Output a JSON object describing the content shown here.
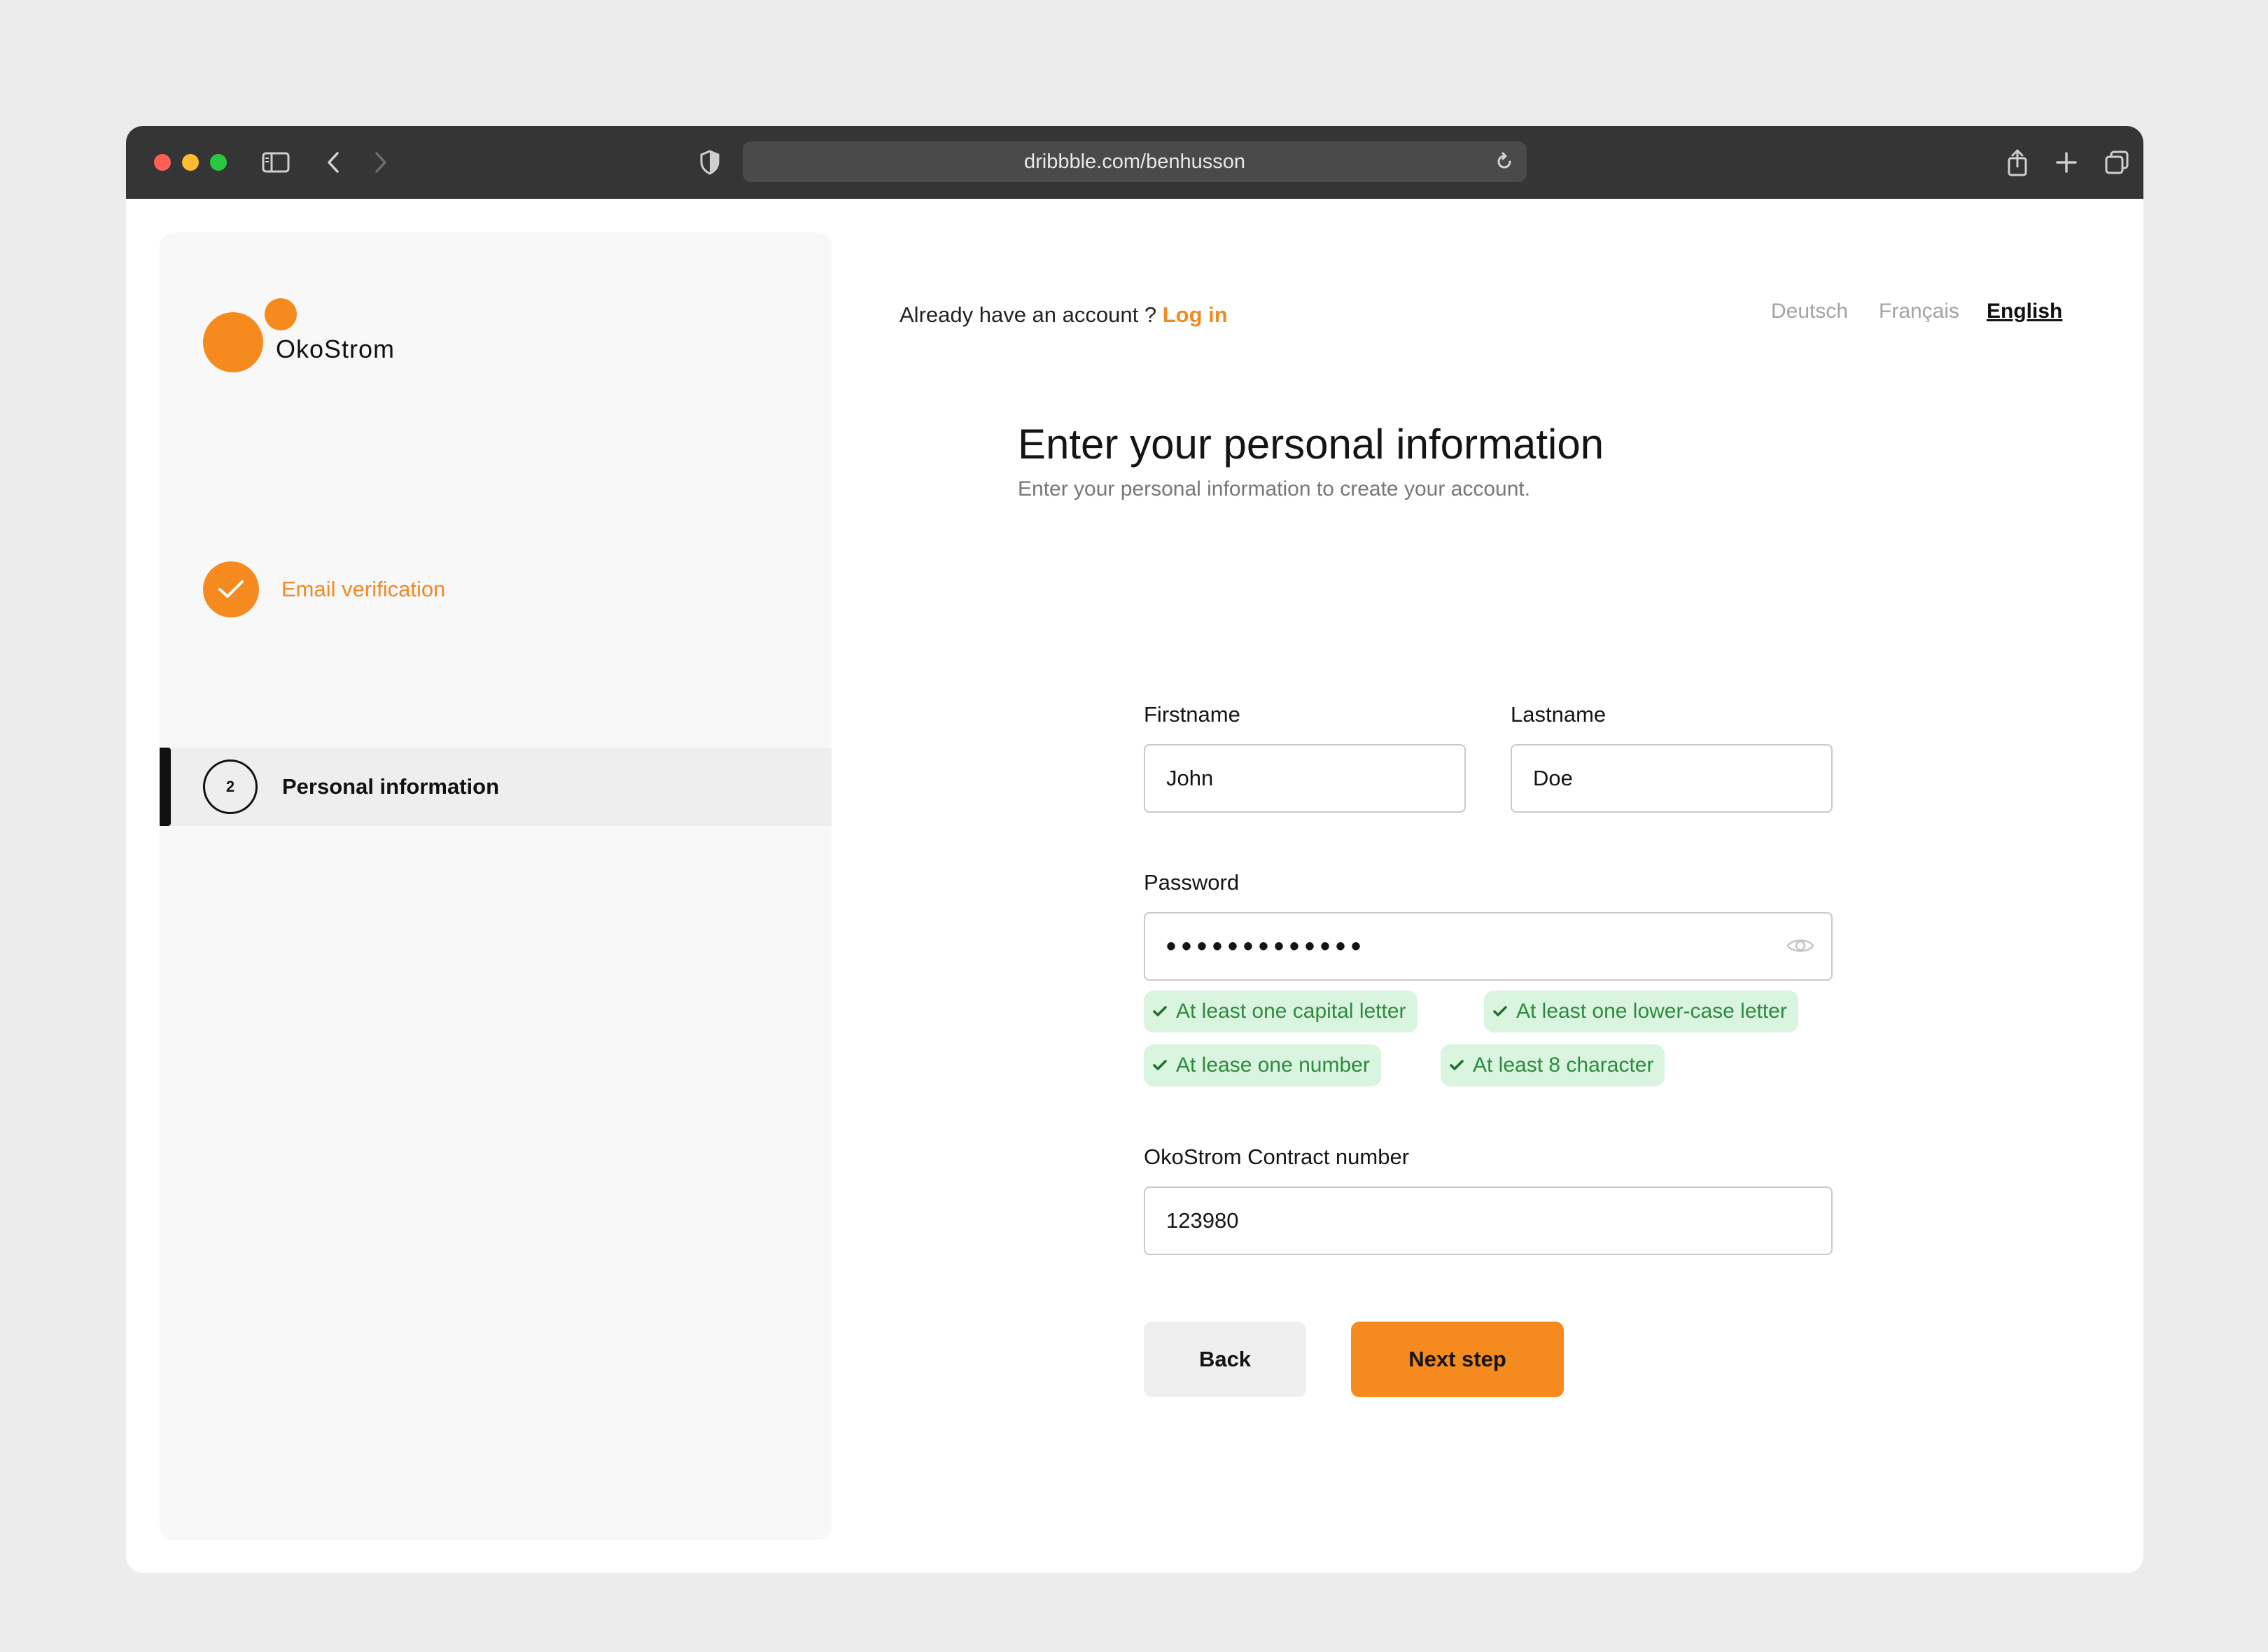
{
  "browser": {
    "url": "dribbble.com/benhusson"
  },
  "brand": {
    "name": "OkoStrom",
    "accent_color": "#f58a1f"
  },
  "steps": [
    {
      "number": "",
      "label": "Email verification",
      "state": "completed"
    },
    {
      "number": "2",
      "label": "Personal information",
      "state": "active"
    }
  ],
  "header": {
    "login_prompt": "Already have an account ?",
    "login_link": "Log in",
    "languages": [
      {
        "label": "Deutsch",
        "active": false
      },
      {
        "label": "Français",
        "active": false
      },
      {
        "label": "English",
        "active": true
      }
    ]
  },
  "form": {
    "title": "Enter your personal information",
    "subtitle": "Enter your personal information to create your account.",
    "firstname": {
      "label": "Firstname",
      "value": "John"
    },
    "lastname": {
      "label": "Lastname",
      "value": "Doe"
    },
    "password": {
      "label": "Password",
      "value": "•••••••••••••",
      "rules": [
        {
          "text": "At least one capital letter",
          "met": true
        },
        {
          "text": "At least one lower-case letter",
          "met": true
        },
        {
          "text": "At lease one number",
          "met": true
        },
        {
          "text": "At least 8 character",
          "met": true
        }
      ]
    },
    "contract": {
      "label": "OkoStrom Contract number",
      "value": "123980"
    },
    "back_label": "Back",
    "next_label": "Next step"
  }
}
